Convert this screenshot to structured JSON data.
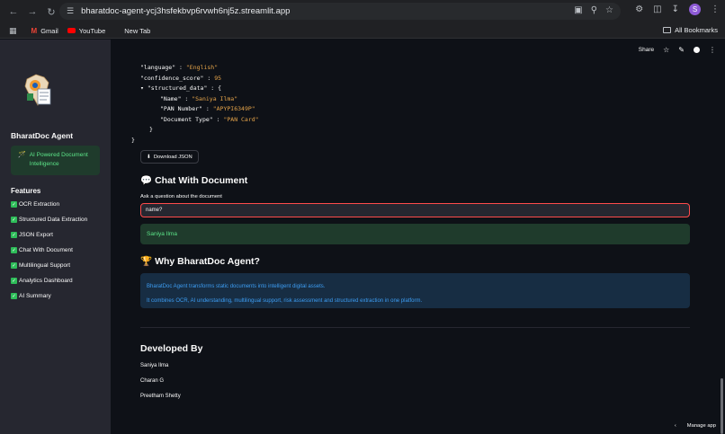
{
  "browser": {
    "url": "bharatdoc-agent-ycj3hsfekbvp6rvwh6nj5z.streamlit.app",
    "avatar_letter": "S",
    "bookmarks": [
      {
        "label": "Gmail",
        "icon": "gmail-icon"
      },
      {
        "label": "YouTube",
        "icon": "youtube-icon"
      },
      {
        "label": "New Tab",
        "icon": "page-icon"
      }
    ],
    "all_bookmarks": "All Bookmarks"
  },
  "sidebar": {
    "title": "BharatDoc Agent",
    "info_icon": "🪄",
    "info_text": "AI Powered Document Intelligence",
    "features_title": "Features",
    "features": [
      "OCR Extraction",
      "Structured Data Extraction",
      "JSON Export",
      "Chat With Document",
      "Multilingual Support",
      "Analytics Dashboard",
      "AI Summary"
    ]
  },
  "topbar": {
    "share": "Share"
  },
  "json_view": {
    "language_key": "\"language\"",
    "language_val": "\"English\"",
    "confidence_key": "\"confidence_score\"",
    "confidence_val": "95",
    "structured_key": "\"structured_data\"",
    "name_key": "\"Name\"",
    "name_val": "\"Saniya Ilma\"",
    "pan_key": "\"PAN Number\"",
    "pan_val": "\"APYPI6349P\"",
    "doctype_key": "\"Document Type\"",
    "doctype_val": "\"PAN Card\""
  },
  "download_label": "Download JSON",
  "chat": {
    "heading": "Chat With Document",
    "heading_icon": "💬",
    "input_label": "Ask a question about the document",
    "input_value": "name?",
    "answer": "Saniya Ilma"
  },
  "why": {
    "heading": "Why BharatDoc Agent?",
    "heading_icon": "🏆",
    "line1": "BharatDoc Agent transforms static documents into intelligent digital assets.",
    "line2": "It combines OCR, AI understanding, multilingual support, risk assessment and structured extraction in one platform."
  },
  "developed": {
    "heading": "Developed By",
    "names": [
      "Saniya Ilma",
      "Charan G",
      "Preetham Shetty"
    ]
  },
  "manage_app": "Manage app"
}
